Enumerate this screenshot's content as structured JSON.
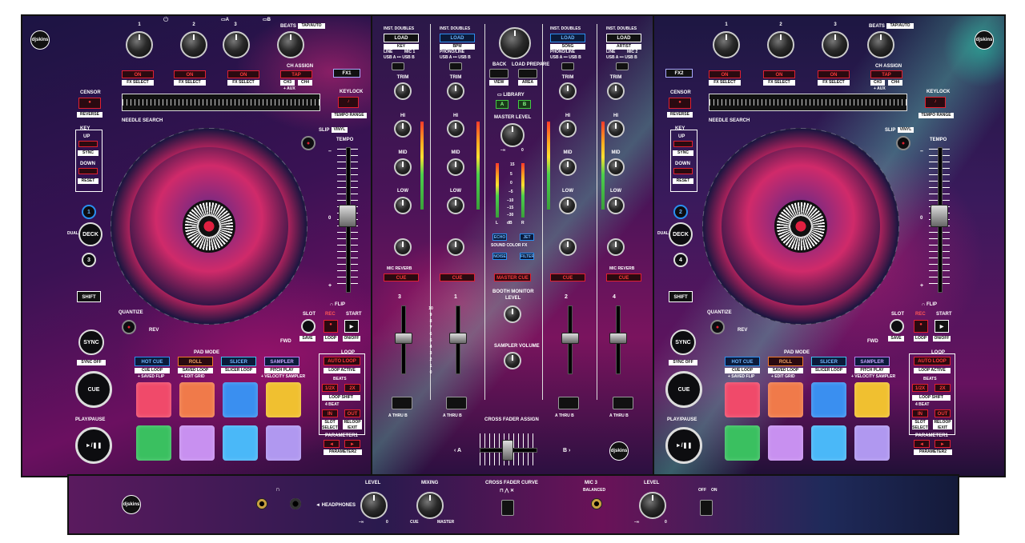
{
  "left_deck": {
    "fx_knob_labels": [
      "1",
      "2",
      "3"
    ],
    "fx_on_labels": [
      "ON",
      "ON",
      "ON"
    ],
    "fx_select": [
      "FX SELECT",
      "FX SELECT",
      "FX SELECT"
    ],
    "beats_label": "BEATS",
    "tap_auto": "TAP/AUTO",
    "tap": "TAP",
    "ch_assign": "CH ASSIGN",
    "ch_a": "CH3",
    "ch_b": "CH4",
    "aux": "+ AUX",
    "fx_label": "FX1",
    "censor": "CENSOR",
    "reverse": "REVERSE",
    "keylock": "KEYLOCK",
    "tempo_range": "TEMPO RANGE",
    "needle_search": "NEEDLE SEARCH",
    "slip": "SLIP",
    "vinyl": "VINYL",
    "tempo": "TEMPO",
    "tempo_marks": [
      "–",
      "0",
      "+"
    ],
    "key": "KEY",
    "up": "UP",
    "sync_small": "SYNC",
    "down": "DOWN",
    "reset": "RESET",
    "dual": "DUAL",
    "deck_top": "1",
    "deck": "DECK",
    "deck_bottom": "3",
    "shift": "SHIFT",
    "quantize": "QUANTIZE",
    "rev": "REV",
    "fwd": "FWD",
    "slot": "SLOT",
    "save": "SAVE",
    "flip": "FLIP",
    "rec": "REC",
    "start": "START",
    "loop_small": "LOOP",
    "on_off": "ON/OFF",
    "sync": "SYNC",
    "sync_off": "SYNC OFF",
    "cue": "CUE",
    "play_pause": "PLAY/PAUSE",
    "pad_mode": "PAD MODE",
    "modes": [
      "HOT CUE",
      "ROLL",
      "SLICER",
      "SAMPLER"
    ],
    "mode_subs": [
      "CUE LOOP",
      "SAVED LOOP",
      "SLICER LOOP",
      "PITCH PLAY"
    ],
    "mode_subs2": [
      "+ SAVED FLIP",
      "+ EDIT GRID",
      "",
      "+ VELOCITY SAMPLER"
    ],
    "loop": "LOOP",
    "auto_loop": "AUTO LOOP",
    "loop_active": "LOOP ACTIVE",
    "beats": "BEATS",
    "half": "1/2X",
    "double": "2X",
    "loop_shift": "LOOP SHIFT",
    "four_beat": "4 BEAT",
    "in": "IN",
    "out": "OUT",
    "slot_select": "SLOT SELECT",
    "reloop_exit": "RELOOP /EXIT",
    "parameter1": "PARAMETER1",
    "parameter2": "PARAMETER2",
    "pad_colors_top": [
      "#f04a6a",
      "#f07a4a",
      "#3a8ff0",
      "#f0c030"
    ],
    "pad_colors_bottom": [
      "#3ac060",
      "#c890f0",
      "#4ab8f8",
      "#b098f0"
    ]
  },
  "right_deck": {
    "fx_label": "FX2",
    "deck_top": "2",
    "deck_bottom": "4",
    "ch_a": "CH3",
    "ch_b": "CH4"
  },
  "mixer": {
    "channels": [
      {
        "num": "3",
        "inst": "INST. DOUBLES",
        "load": "LOAD",
        "info": "KEY",
        "line": "LINE",
        "mic": "MIC 1",
        "usb": "USB A ••• USB B"
      },
      {
        "num": "1",
        "inst": "INST. DOUBLES",
        "load": "LOAD",
        "info": "BPM",
        "line": "PHONO/LINE",
        "mic": "",
        "usb": "USB A ••• USB B"
      },
      {
        "num": "2",
        "inst": "INST. DOUBLES",
        "load": "LOAD",
        "info": "SONG",
        "line": "PHONO/LINE",
        "mic": "",
        "usb": "USB A ••• USB B"
      },
      {
        "num": "4",
        "inst": "INST. DOUBLES",
        "load": "LOAD",
        "info": "ARTIST",
        "line": "LINE",
        "mic": "MIC 2",
        "usb": "USB A ••• USB B"
      }
    ],
    "trim": "TRIM",
    "hi": "HI",
    "mid": "MID",
    "low": "LOW",
    "knob_range_lo": "–26",
    "knob_range_hi": "+6",
    "trim_lo": "–∞",
    "trim_hi": "+9",
    "filter_low": "LOW",
    "filter_hi": "HI",
    "cue": "CUE",
    "mic_reverb": "MIC REVERB",
    "back": "BACK",
    "view": "VIEW",
    "load_prepare": "LOAD PREPARE",
    "area": "AREA",
    "library": "LIBRARY",
    "lib_a": "A",
    "lib_b": "B",
    "master_level": "MASTER LEVEL",
    "master_lo": "–∞",
    "master_hi": "0",
    "meter_scale": [
      "15",
      "5",
      "0",
      "–5",
      "–10",
      "–15",
      "–30"
    ],
    "meter_l": "L",
    "meter_db": "dB",
    "meter_r": "R",
    "echo": "ECHO",
    "jet": "JET",
    "sound_color_fx": "SOUND COLOR FX",
    "noise": "NOISE",
    "filter": "FILTER",
    "master_cue": "MASTER CUE",
    "booth_monitor": "BOOTH MONITOR",
    "level": "LEVEL",
    "sampler_volume": "SAMPLER VOLUME",
    "fader_scale": [
      "10",
      "9",
      "8",
      "7",
      "6",
      "5",
      "4",
      "3",
      "2",
      "1",
      "0"
    ],
    "thru": "A  THRU  B",
    "cross_fader_assign": "CROSS FADER ASSIGN",
    "xf_a": "A",
    "xf_b": "B"
  },
  "front": {
    "headphones": "HEADPHONES",
    "level": "LEVEL",
    "mixing": "MIXING",
    "cue": "CUE",
    "master": "MASTER",
    "lo": "–∞",
    "hi": "0",
    "cross_fader_curve": "CROSS FADER CURVE",
    "mic3": "MIC 3",
    "balanced": "BALANCED",
    "mic_level": "LEVEL",
    "off": "OFF",
    "on": "ON"
  },
  "brand": "djskins"
}
